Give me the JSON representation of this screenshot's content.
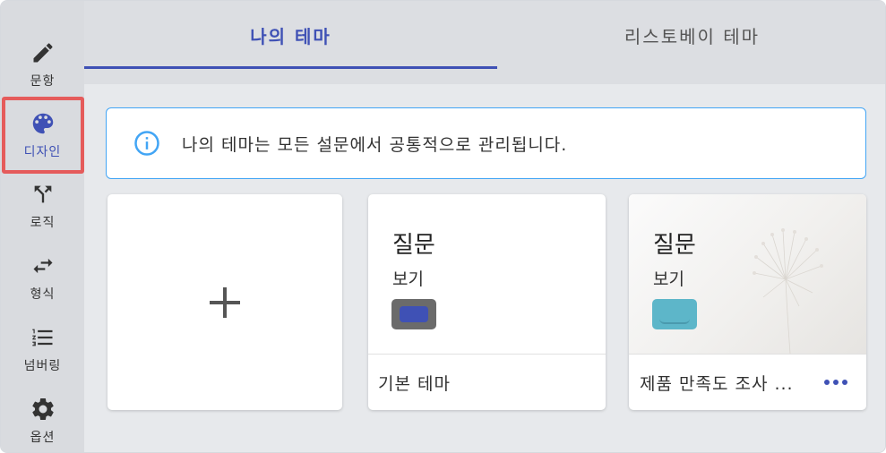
{
  "sidebar": {
    "items": [
      {
        "label": "문항",
        "icon": "pencil-icon"
      },
      {
        "label": "디자인",
        "icon": "palette-icon",
        "active": true
      },
      {
        "label": "로직",
        "icon": "branch-icon"
      },
      {
        "label": "형식",
        "icon": "swap-arrows-icon"
      },
      {
        "label": "넘버링",
        "icon": "numbered-list-icon"
      },
      {
        "label": "옵션",
        "icon": "gear-icon"
      }
    ]
  },
  "tabs": [
    {
      "label": "나의 테마",
      "active": true
    },
    {
      "label": "리스토베이 테마",
      "active": false
    }
  ],
  "notice": {
    "text": "나의 테마는 모든 설문에서 공통적으로 관리됩니다.",
    "icon": "info-icon"
  },
  "cards": [
    {
      "type": "add",
      "icon": "plus-icon"
    },
    {
      "question": "질문",
      "view": "보기",
      "name": "기본 테마",
      "swatch": "#3f51b5"
    },
    {
      "question": "질문",
      "view": "보기",
      "name": "제품 만족도 조사 ...",
      "swatch": "#5db6c9",
      "more_icon": "more-dots-icon"
    }
  ],
  "colors": {
    "accent": "#3f51b5",
    "info": "#42a5f5",
    "highlight": "#e55b5b"
  }
}
